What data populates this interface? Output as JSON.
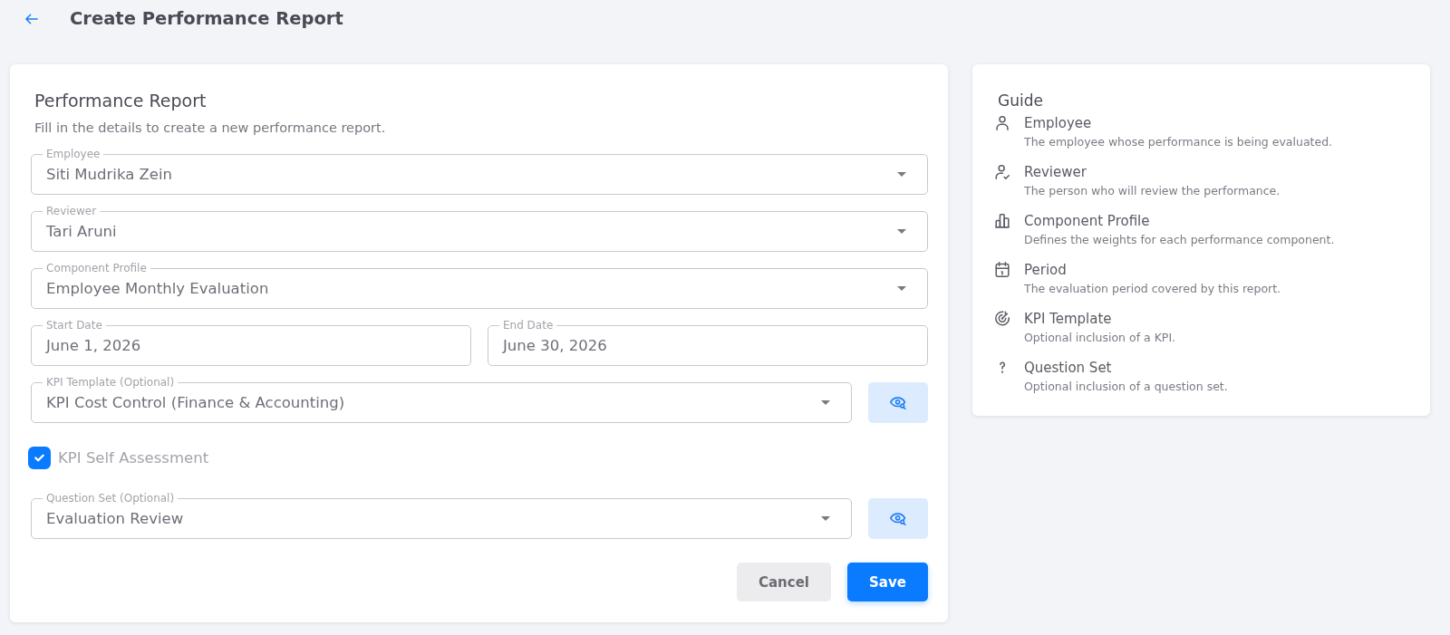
{
  "header": {
    "title": "Create Performance Report"
  },
  "form": {
    "title": "Performance Report",
    "subtitle": "Fill in the details to create a new performance report.",
    "rows": [
      {
        "kind": "select",
        "label": "Employee",
        "value": "Siti Mudrika Zein"
      },
      {
        "kind": "select",
        "label": "Reviewer",
        "value": "Tari Aruni"
      },
      {
        "kind": "select",
        "label": "Component Profile",
        "value": "Employee Monthly Evaluation"
      },
      {
        "kind": "dates",
        "fields": [
          {
            "label": "Start Date",
            "value": "June 1, 2026"
          },
          {
            "label": "End Date",
            "value": "June 30, 2026"
          }
        ]
      },
      {
        "kind": "select_preview",
        "label": "KPI Template (Optional)",
        "value": "KPI Cost Control (Finance & Accounting)"
      },
      {
        "kind": "checkbox",
        "label": "KPI Self Assessment",
        "checked": true
      },
      {
        "kind": "select_preview",
        "label": "Question Set (Optional)",
        "value": "Evaluation Review"
      }
    ],
    "buttons": [
      {
        "kind": "secondary",
        "label": "Cancel"
      },
      {
        "kind": "primary",
        "label": "Save"
      }
    ]
  },
  "guide": {
    "title": "Guide",
    "items": [
      {
        "title": "Employee",
        "description": "The employee whose performance is being evaluated."
      },
      {
        "title": "Reviewer",
        "description": "The person who will review the performance."
      },
      {
        "title": "Component Profile",
        "description": "Defines the weights for each performance component."
      },
      {
        "title": "Period",
        "description": "The evaluation period covered by this report."
      },
      {
        "title": "KPI Template",
        "description": "Optional inclusion of a KPI."
      },
      {
        "title": "Question Set",
        "description": "Optional inclusion of a question set."
      }
    ]
  }
}
